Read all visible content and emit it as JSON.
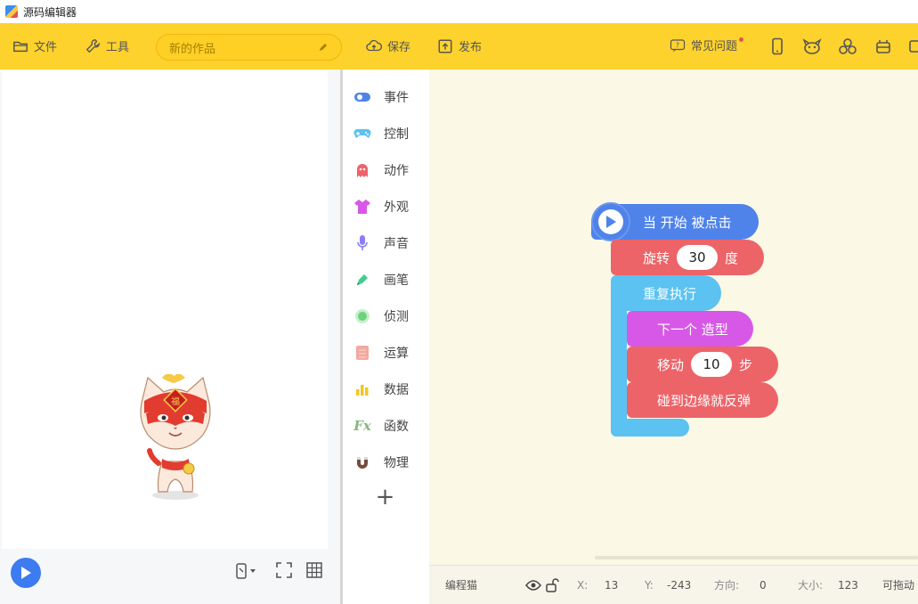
{
  "window": {
    "title": "源码编辑器"
  },
  "toolbar": {
    "file_label": "文件",
    "tools_label": "工具",
    "project_name": "新的作品",
    "save_label": "保存",
    "publish_label": "发布",
    "faq_label": "常见问题"
  },
  "categories": [
    {
      "label": "事件",
      "icon": "toggle-icon",
      "color": "#4f83ea"
    },
    {
      "label": "控制",
      "icon": "gamepad-icon",
      "color": "#5bc2f1"
    },
    {
      "label": "动作",
      "icon": "ghost-icon",
      "color": "#ec6368"
    },
    {
      "label": "外观",
      "icon": "shirt-icon",
      "color": "#d758e6"
    },
    {
      "label": "声音",
      "icon": "microphone-icon",
      "color": "#8c7ef5"
    },
    {
      "label": "画笔",
      "icon": "pen-icon",
      "color": "#3ecf8e"
    },
    {
      "label": "侦测",
      "icon": "radar-icon",
      "color": "#6bd37a"
    },
    {
      "label": "运算",
      "icon": "calculator-icon",
      "color": "#f2a9a0"
    },
    {
      "label": "数据",
      "icon": "bar-chart-icon",
      "color": "#f3c428"
    },
    {
      "label": "函数",
      "icon": "fx-icon",
      "color": "#86b77d"
    },
    {
      "label": "物理",
      "icon": "magnet-icon",
      "color": "#7a4a3a"
    }
  ],
  "blocks": {
    "when_clicked": "当 开始 被点击",
    "turn_label": "旋转",
    "turn_value": "30",
    "turn_unit": "度",
    "repeat_label": "重复执行",
    "next_costume": "下一个 造型",
    "move_label": "移动",
    "move_value": "10",
    "move_unit": "步",
    "bounce_label": "碰到边缘就反弹"
  },
  "sprite": {
    "name": "编程猫",
    "x_label": "X:",
    "x_value": "13",
    "y_label": "Y:",
    "y_value": "-243",
    "direction_label": "方向:",
    "direction_value": "0",
    "size_label": "大小:",
    "size_value": "123",
    "draggable_label": "可拖动"
  },
  "colors": {
    "toolbar": "#fdd22c",
    "workspace": "#fbf8e6",
    "event": "#4f83ea",
    "motion": "#ec6368",
    "control": "#5bc2f1",
    "looks": "#d758e6"
  }
}
